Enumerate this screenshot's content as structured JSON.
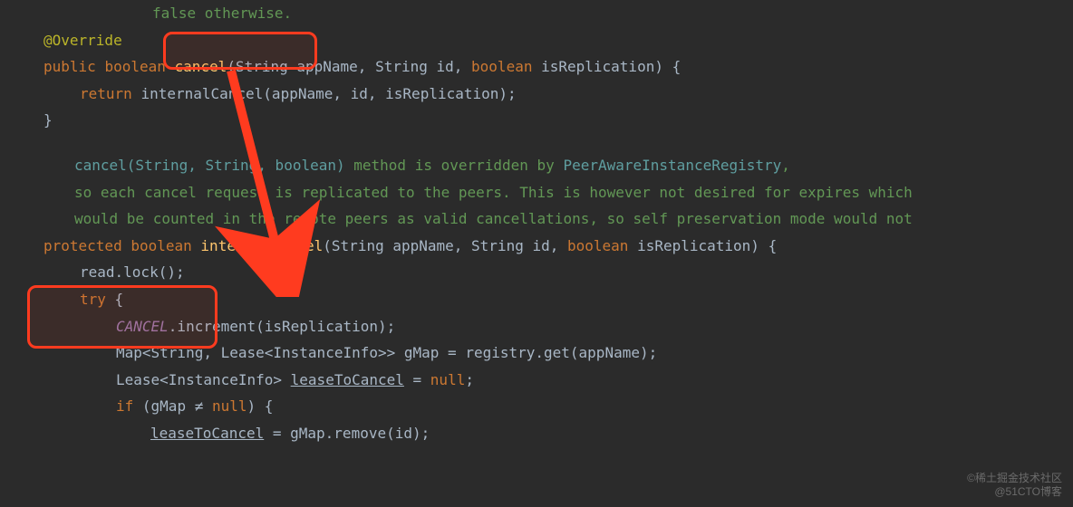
{
  "doc_top": {
    "text": "false otherwise."
  },
  "annotation": {
    "override": "@Override"
  },
  "signature1": {
    "access": "public",
    "ret": "boolean",
    "name": "cancel",
    "params": "(String appName, String id, ",
    "bool_kw": "boolean",
    "params_tail": " isReplication) {"
  },
  "line_return": {
    "kw": "return ",
    "call": "internalCancel",
    "args": "(appName, id, isReplication);"
  },
  "brace_close": "}",
  "doc_comment": {
    "l1a": "cancel(String, String, boolean)",
    "l1b": " method is overridden by ",
    "l1c": "PeerAwareInstanceRegistry",
    "l1d": ",",
    "l2": "so each cancel request is replicated to the peers. This is however not desired for expires which",
    "l3": "would be counted in the remote peers as valid cancellations, so self preservation mode would not"
  },
  "signature2": {
    "access": "protected",
    "ret": "boolean",
    "name": "internalCancel",
    "params": "(String appName, String id, ",
    "bool_kw": "boolean",
    "params_tail": " isReplication) {"
  },
  "readlock": {
    "obj": "read",
    "dot": ".lock();"
  },
  "try_line": {
    "kw": "try",
    "tail": " {"
  },
  "cancel_inc": {
    "obj": "CANCEL",
    "tail": ".increment(isReplication);"
  },
  "map_line": {
    "p1": "Map<String, Lease<",
    "type": "InstanceInfo",
    "p2": ">> gMap = registry",
    "dot": ".get(appName);"
  },
  "lease_line": {
    "p1": "Lease<",
    "type": "InstanceInfo",
    "p2": "> ",
    "var": "leaseToCancel",
    "p3": " = ",
    "null_kw": "null",
    "p4": ";"
  },
  "if_line": {
    "kw": "if ",
    "cond1": "(gMap ",
    "neq": "≠",
    "cond2": " ",
    "null_kw": "null",
    "cond3": ") {"
  },
  "assign_line": {
    "var": "leaseToCancel",
    "p1": " = gMap.remove(id);"
  },
  "watermark": {
    "l1": "©稀土掘金技术社区",
    "l2": "@51CTO博客"
  }
}
